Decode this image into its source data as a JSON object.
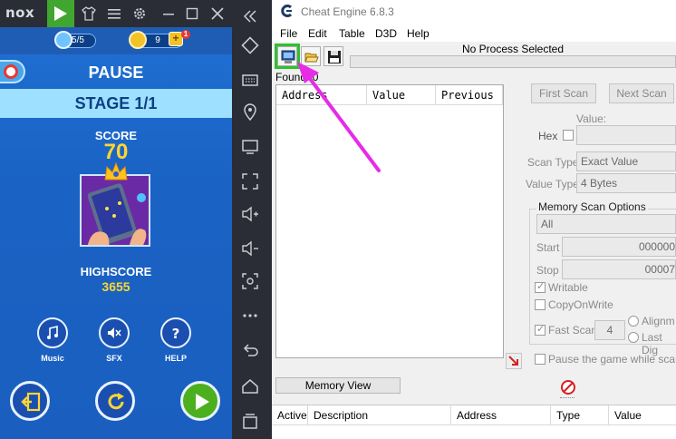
{
  "nox": {
    "logo": "nox",
    "game": {
      "lives": "5/5",
      "coins": "9",
      "notification_count": "1",
      "plus_label": "+",
      "pause_title": "PAUSE",
      "stage": "STAGE 1/1",
      "score_label": "SCORE",
      "score_value": "70",
      "highscore_label": "HIGHSCORE",
      "highscore_value": "3655",
      "buttons": [
        {
          "label": "Music",
          "icon": "music-icon"
        },
        {
          "label": "SFX",
          "icon": "speaker-muted-icon"
        },
        {
          "label": "HELP",
          "icon": "help-icon"
        }
      ],
      "big_buttons": [
        {
          "icon": "exit-icon",
          "color": "#1a4fb0"
        },
        {
          "icon": "restart-icon",
          "color": "#1a4fb0"
        },
        {
          "icon": "play-icon",
          "color": "#4caf1e"
        }
      ]
    },
    "side_toolbar": [
      "collapse-icon",
      "eraser-icon",
      "keyboard-icon",
      "location-icon",
      "screen-icon",
      "fullscreen-icon",
      "volume-up-icon",
      "volume-down-icon",
      "screenshot-icon",
      "more-icon",
      "back-icon",
      "home-icon",
      "recent-apps-icon"
    ]
  },
  "ce": {
    "title": "Cheat Engine 6.8.3",
    "menu": [
      "File",
      "Edit",
      "Table",
      "D3D",
      "Help"
    ],
    "process_label": "No Process Selected",
    "found_label": "Found: 0",
    "results_columns": [
      "Address",
      "Value",
      "Previous"
    ],
    "first_scan": "First Scan",
    "next_scan": "Next Scan",
    "value_label": "Value:",
    "hex_label": "Hex",
    "scan_type_label": "Scan Type",
    "scan_type_value": "Exact Value",
    "value_type_label": "Value Type",
    "value_type_value": "4 Bytes",
    "memory_options_title": "Memory Scan Options",
    "memory_region": "All",
    "start_label": "Start",
    "start_value": "000000",
    "stop_label": "Stop",
    "stop_value": "00007",
    "writable_label": "Writable",
    "copy_on_write_label": "CopyOnWrite",
    "fast_scan_label": "Fast Scan",
    "fast_scan_value": "4",
    "alignment_label": "Alignm",
    "last_digits_label": "Last Dig",
    "pause_label": "Pause the game while scann",
    "memory_view": "Memory View",
    "address_list_columns": [
      "Active",
      "Description",
      "Address",
      "Type",
      "Value"
    ],
    "accent_color": "#e62ce6"
  }
}
